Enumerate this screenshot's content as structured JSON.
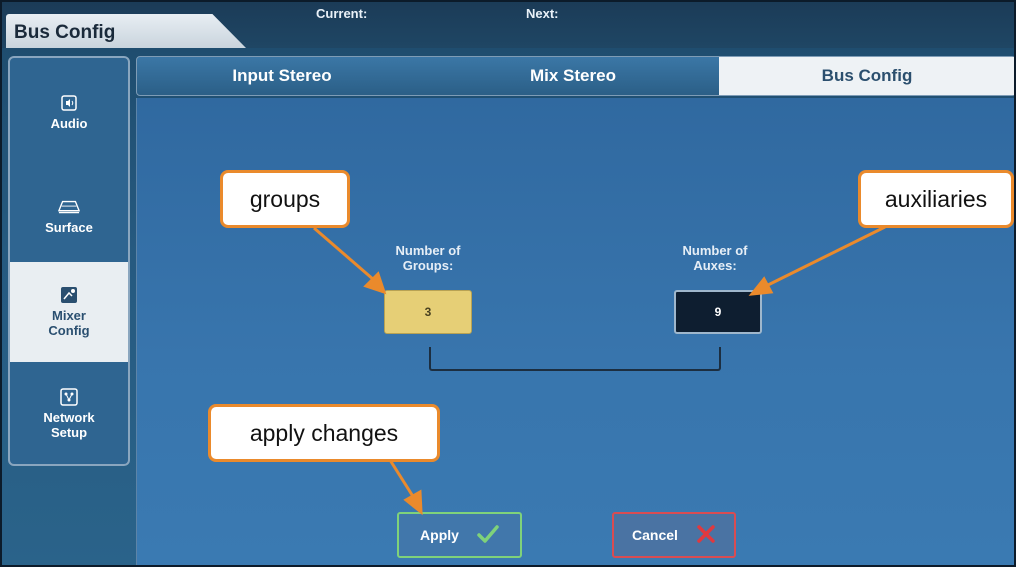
{
  "header": {
    "title_tab": "Bus Config",
    "current_label": "Current:",
    "next_label": "Next:"
  },
  "sidebar": {
    "items": [
      {
        "label": "Audio",
        "icon": "speaker-icon",
        "active": false
      },
      {
        "label": "Surface",
        "icon": "surface-icon",
        "active": false
      },
      {
        "label": "Mixer Config",
        "icon": "mixer-config-icon",
        "active": true
      },
      {
        "label": "Network Setup",
        "icon": "network-icon",
        "active": false
      }
    ]
  },
  "tabs": [
    {
      "label": "Input Stereo",
      "active": false
    },
    {
      "label": "Mix Stereo",
      "active": false
    },
    {
      "label": "Bus Config",
      "active": true
    }
  ],
  "bus_config": {
    "groups_label": "Number of Groups:",
    "groups_value": "3",
    "aux_label": "Number of Auxes:",
    "aux_value": "9"
  },
  "buttons": {
    "apply": "Apply",
    "cancel": "Cancel"
  },
  "annotations": {
    "groups": "groups",
    "auxiliaries": "auxiliaries",
    "apply_changes": "apply changes"
  },
  "colors": {
    "accent_orange": "#ea8a2c",
    "groups_yellow": "#e6cf76",
    "apply_green": "#7fd27a",
    "cancel_red": "#d94c52"
  }
}
